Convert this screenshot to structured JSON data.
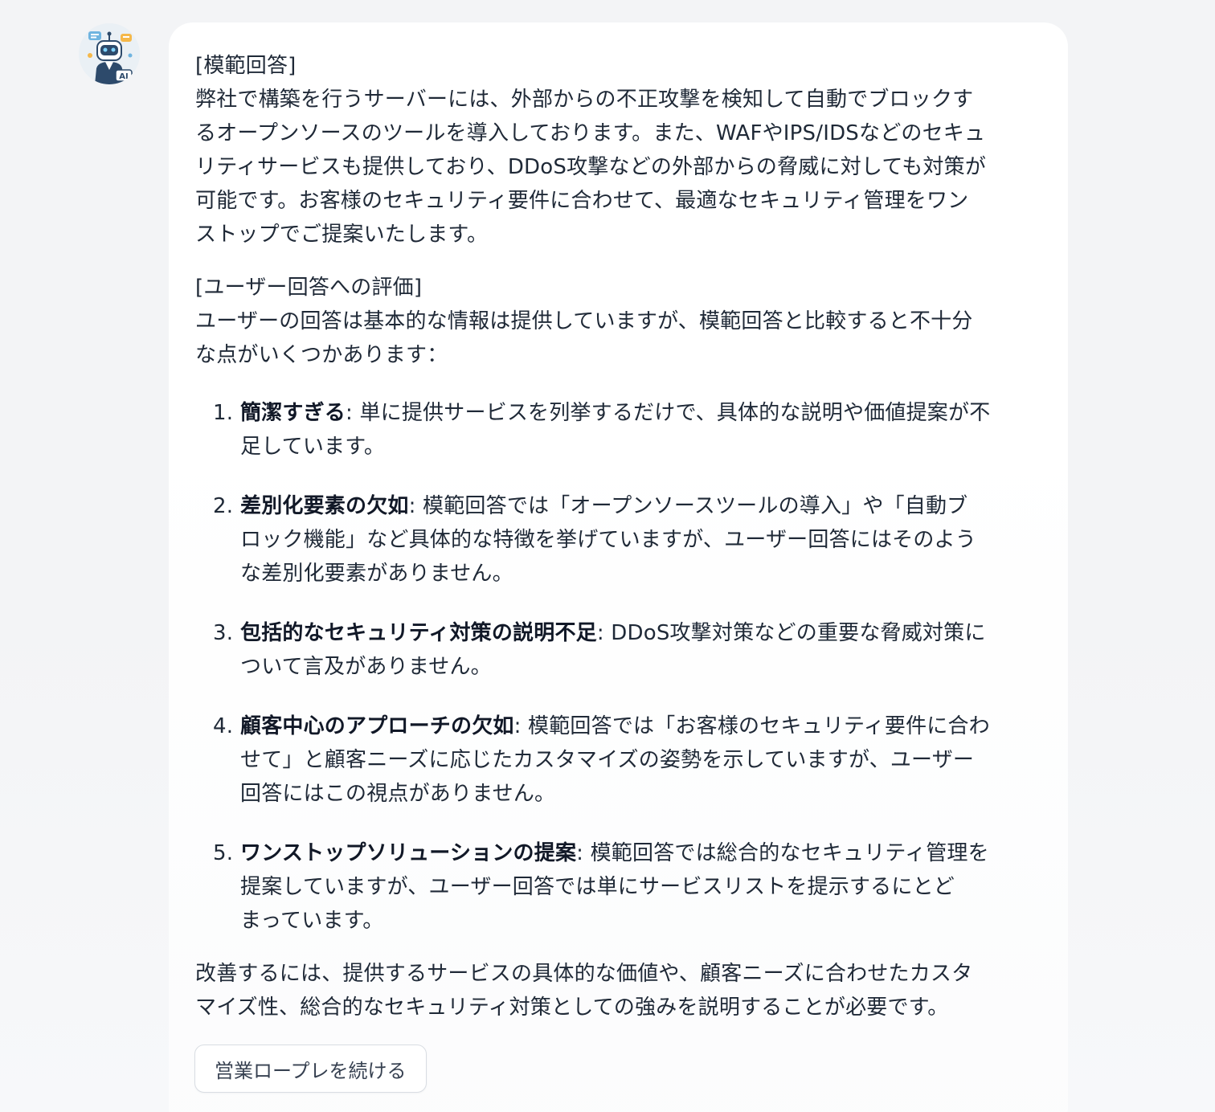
{
  "assistant": {
    "avatar_icon": "robot-ai-icon",
    "avatar_badge": "AI"
  },
  "message": {
    "model_answer_heading": "[模範回答]",
    "model_answer_lines": [
      "弊社で構築を行うサーバーには、外部からの不正攻撃を検知して自動でブロックす",
      "るオープンソースのツールを導入しております。また、WAFやIPS/IDSなどのセキュ",
      "リティサービスも提供しており、DDoS攻撃などの外部からの脅威に対しても対策が",
      "可能です。お客様のセキュリティ要件に合わせて、最適なセキュリティ管理をワン",
      "ストップでご提案いたします。"
    ],
    "evaluation_heading": "[ユーザー回答への評価]",
    "evaluation_lines": [
      "ユーザーの回答は基本的な情報は提供していますが、模範回答と比較すると不十分",
      "な点がいくつかあります："
    ],
    "points": [
      {
        "number": "1.",
        "title": "簡潔すぎる",
        "lines": [
          ": 単に提供サービスを列挙するだけで、具体的な説明や価値提案が不",
          "足しています。"
        ]
      },
      {
        "number": "2.",
        "title": "差別化要素の欠如",
        "lines": [
          ": 模範回答では「オープンソースツールの導入」や「自動ブ",
          "ロック機能」など具体的な特徴を挙げていますが、ユーザー回答にはそのよう",
          "な差別化要素がありません。"
        ]
      },
      {
        "number": "3.",
        "title": "包括的なセキュリティ対策の説明不足",
        "lines": [
          ": DDoS攻撃対策などの重要な脅威対策に",
          "ついて言及がありません。"
        ]
      },
      {
        "number": "4.",
        "title": "顧客中心のアプローチの欠如",
        "lines": [
          ": 模範回答では「お客様のセキュリティ要件に合わ",
          "せて」と顧客ニーズに応じたカスタマイズの姿勢を示していますが、ユーザー",
          "回答にはこの視点がありません。"
        ]
      },
      {
        "number": "5.",
        "title": "ワンストップソリューションの提案",
        "lines": [
          ": 模範回答では総合的なセキュリティ管理を",
          "提案していますが、ユーザー回答では単にサービスリストを提示するにとど",
          "まっています。"
        ]
      }
    ],
    "closing_lines": [
      "改善するには、提供するサービスの具体的な価値や、顧客ニーズに合わせたカスタ",
      "マイズ性、総合的なセキュリティ対策としての強みを説明することが必要です。"
    ]
  },
  "actions": {
    "continue_label": "営業ロープレを続ける"
  }
}
